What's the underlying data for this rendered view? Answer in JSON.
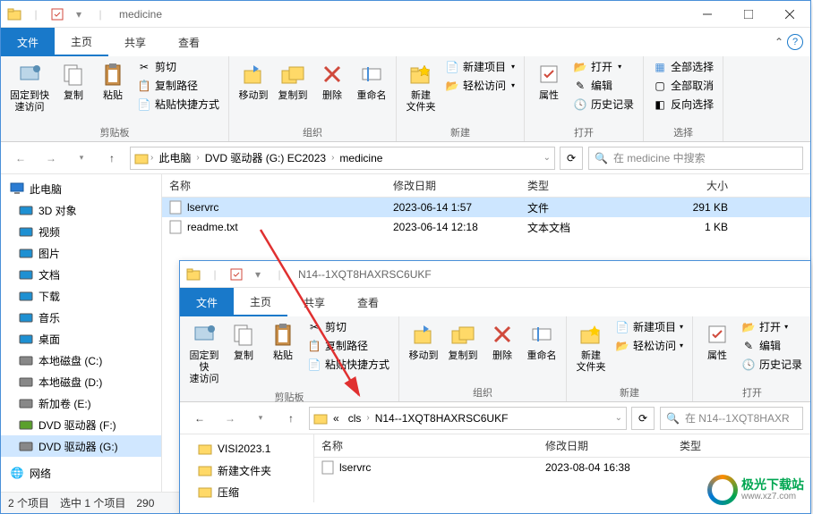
{
  "outer": {
    "title": "medicine",
    "tabs": {
      "file": "文件",
      "home": "主页",
      "share": "共享",
      "view": "查看"
    },
    "ribbon": {
      "pin": "固定到快\n速访问",
      "copy": "复制",
      "paste": "粘贴",
      "cut": "剪切",
      "copyPath": "复制路径",
      "pasteShortcut": "粘贴快捷方式",
      "clipboardGroup": "剪贴板",
      "moveTo": "移动到",
      "copyTo": "复制到",
      "delete": "删除",
      "rename": "重命名",
      "organizeGroup": "组织",
      "newFolder": "新建\n文件夹",
      "newItem": "新建项目",
      "easyAccess": "轻松访问",
      "newGroup": "新建",
      "properties": "属性",
      "open": "打开",
      "edit": "编辑",
      "history": "历史记录",
      "openGroup": "打开",
      "selectAll": "全部选择",
      "selectNone": "全部取消",
      "invertSel": "反向选择",
      "selectGroup": "选择"
    },
    "breadcrumb": [
      "此电脑",
      "DVD 驱动器 (G:) EC2023",
      "medicine"
    ],
    "searchPlaceholder": "在 medicine 中搜索",
    "columns": {
      "name": "名称",
      "date": "修改日期",
      "type": "类型",
      "size": "大小"
    },
    "files": [
      {
        "name": "lservrc",
        "date": "2023-06-14 1:57",
        "type": "文件",
        "size": "291 KB",
        "selected": true
      },
      {
        "name": "readme.txt",
        "date": "2023-06-14 12:18",
        "type": "文本文档",
        "size": "1 KB",
        "selected": false
      }
    ],
    "tree": {
      "root": "此电脑",
      "items": [
        {
          "label": "3D 对象",
          "color": "#1e90d2"
        },
        {
          "label": "视频",
          "color": "#1e90d2"
        },
        {
          "label": "图片",
          "color": "#1e90d2"
        },
        {
          "label": "文档",
          "color": "#1e90d2"
        },
        {
          "label": "下载",
          "color": "#1e90d2"
        },
        {
          "label": "音乐",
          "color": "#1e90d2"
        },
        {
          "label": "桌面",
          "color": "#1e90d2"
        },
        {
          "label": "本地磁盘 (C:)",
          "color": "#888"
        },
        {
          "label": "本地磁盘 (D:)",
          "color": "#888"
        },
        {
          "label": "新加卷 (E:)",
          "color": "#888"
        },
        {
          "label": "DVD 驱动器 (F:)",
          "color": "#5aa02c"
        },
        {
          "label": "DVD 驱动器 (G:)",
          "color": "#888",
          "selected": true
        }
      ],
      "network": "网络"
    },
    "status": {
      "items": "2 个项目",
      "selected": "选中 1 个项目",
      "size": "290"
    }
  },
  "inner": {
    "title": "N14--1XQT8HAXRSC6UKF",
    "tabs": {
      "file": "文件",
      "home": "主页",
      "share": "共享",
      "view": "查看"
    },
    "ribbon": {
      "pin": "固定到快\n速访问",
      "copy": "复制",
      "paste": "粘贴",
      "cut": "剪切",
      "copyPath": "复制路径",
      "pasteShortcut": "粘贴快捷方式",
      "clipboardGroup": "剪贴板",
      "moveTo": "移动到",
      "copyTo": "复制到",
      "delete": "删除",
      "rename": "重命名",
      "organizeGroup": "组织",
      "newFolder": "新建\n文件夹",
      "newItem": "新建项目",
      "easyAccess": "轻松访问",
      "newGroup": "新建",
      "properties": "属性",
      "open": "打开",
      "edit": "编辑",
      "history": "历史记录",
      "openGroup": "打开"
    },
    "breadcrumb": [
      "«",
      "cls",
      "N14--1XQT8HAXRSC6UKF"
    ],
    "searchPlaceholder": "在 N14--1XQT8HAXR",
    "columns": {
      "name": "名称",
      "date": "修改日期",
      "type": "类型"
    },
    "tree": [
      {
        "label": "VISI2023.1"
      },
      {
        "label": "新建文件夹"
      },
      {
        "label": "压缩"
      }
    ],
    "files": [
      {
        "name": "lservrc",
        "date": "2023-08-04 16:38",
        "type": ""
      }
    ]
  },
  "watermark": {
    "line1": "极光下载站",
    "line2": "www.xz7.com"
  }
}
